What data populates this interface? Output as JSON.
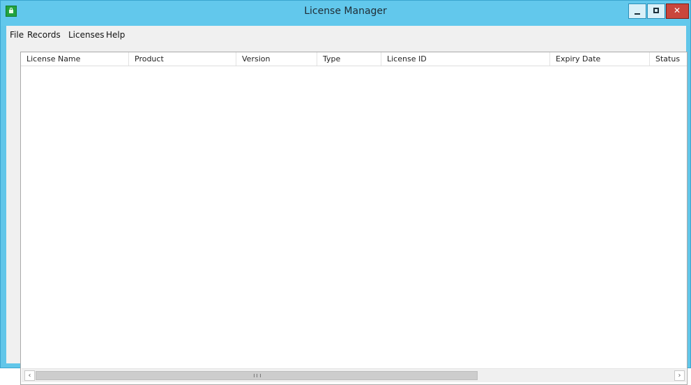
{
  "window": {
    "title": "License Manager",
    "icon": "green-lock-icon",
    "controls": [
      "minimize",
      "maximize",
      "close"
    ],
    "colors": {
      "titlebar": "#62c8ec",
      "close": "#c9463c"
    }
  },
  "menu": {
    "items": [
      {
        "label": "File"
      },
      {
        "label": "Records"
      },
      {
        "label": "Licenses"
      },
      {
        "label": "Help"
      }
    ]
  },
  "table": {
    "columns": [
      {
        "label": "License Name"
      },
      {
        "label": "Product"
      },
      {
        "label": "Version"
      },
      {
        "label": "Type"
      },
      {
        "label": "License ID"
      },
      {
        "label": "Expiry Date"
      },
      {
        "label": "Status"
      }
    ],
    "rows": []
  },
  "scrollbar": {
    "left_arrow": "‹",
    "right_arrow": "›"
  }
}
